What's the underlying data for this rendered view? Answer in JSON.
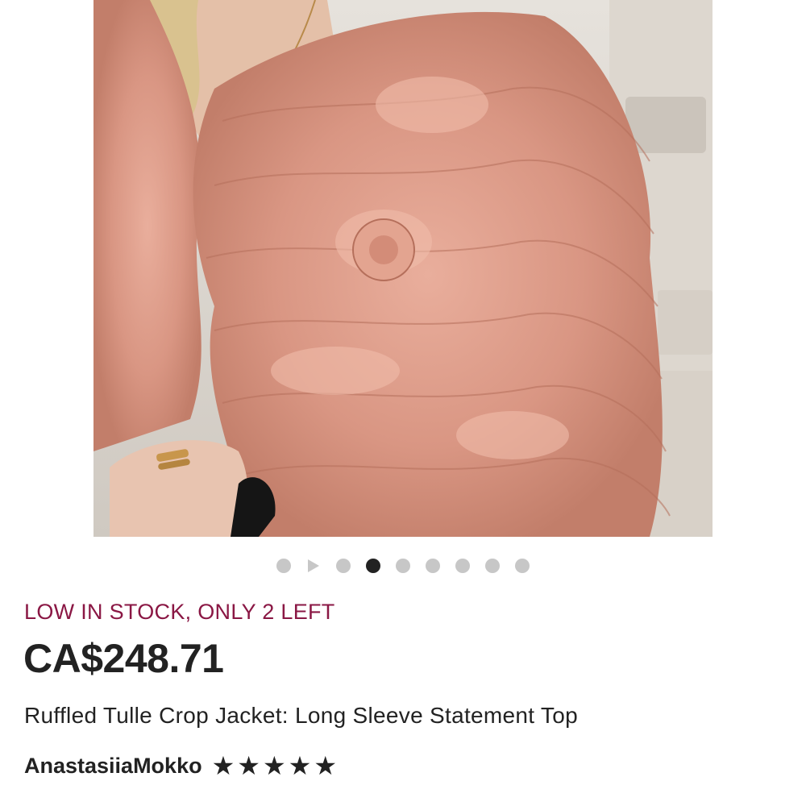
{
  "gallery": {
    "image_alt": "Ruffled pink tulle crop jacket worn by model",
    "image_count": 9,
    "active_index": 3,
    "has_video_slide": true
  },
  "product": {
    "stock_notice": "LOW IN STOCK, ONLY 2 LEFT",
    "price": "CA$248.71",
    "title": "Ruffled Tulle Crop Jacket: Long Sleeve Statement Top",
    "seller": "AnastasiiaMokko",
    "rating": 5,
    "rating_max": 5
  },
  "colors": {
    "stock_notice": "#8a1744",
    "text": "#222222",
    "dot_inactive": "#c7c7c7",
    "dot_active": "#222222"
  },
  "icons": {
    "video": "play-icon",
    "rating": "star-icon"
  }
}
